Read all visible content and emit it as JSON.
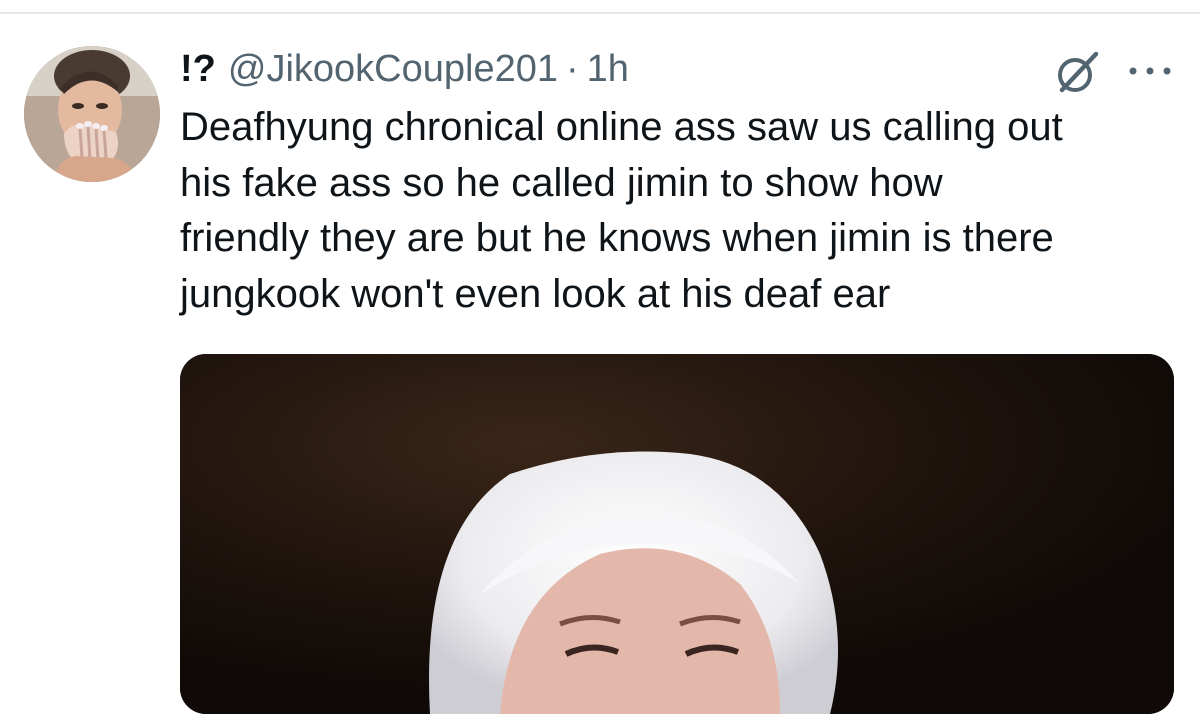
{
  "tweet": {
    "display_name": "!?",
    "handle": "@JikookCouple201",
    "separator": "·",
    "time": "1h",
    "text_lines": [
      "Deafhyung chronical online ass saw us calling out",
      "his fake ass so he called jimin to show how",
      "friendly they are but he knows when jimin is there",
      "jungkook won't even look at his deaf ear"
    ]
  },
  "icons": {
    "avatar": "avatar",
    "grok": "grok-icon",
    "more": "more-icon"
  },
  "colors": {
    "text_primary": "#0f1419",
    "text_secondary": "#536471",
    "divider": "#e6e9eb",
    "media_background": "#1a110c"
  }
}
